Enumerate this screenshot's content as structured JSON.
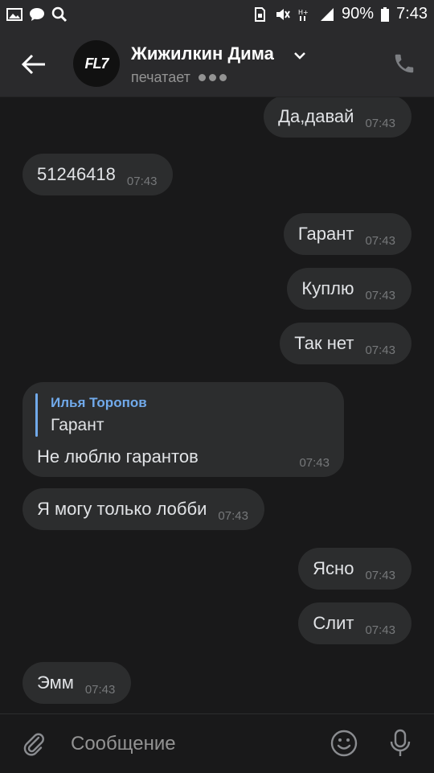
{
  "statusbar": {
    "battery": "90%",
    "time": "7:43"
  },
  "header": {
    "contact_name": "Жижилкин Дима",
    "status": "печатает",
    "avatar_text": "FL7"
  },
  "messages": [
    {
      "text": "Да,давай",
      "time": "07:43",
      "side": "out"
    },
    {
      "text": "51246418",
      "time": "07:43",
      "side": "in"
    },
    {
      "text": "Гарант",
      "time": "07:43",
      "side": "out"
    },
    {
      "text": "Куплю",
      "time": "07:43",
      "side": "out"
    },
    {
      "text": "Так нет",
      "time": "07:43",
      "side": "out"
    },
    {
      "text": "Я могу только лобби",
      "time": "07:43",
      "side": "in"
    },
    {
      "text": "Ясно",
      "time": "07:43",
      "side": "out"
    },
    {
      "text": "Слит",
      "time": "07:43",
      "side": "out"
    },
    {
      "text": "Эмм",
      "time": "07:43",
      "side": "in"
    }
  ],
  "reply_message": {
    "author": "Илья Торопов",
    "quoted": "Гарант",
    "text": "Не люблю гарантов",
    "time": "07:43"
  },
  "composer": {
    "placeholder": "Сообщение"
  },
  "colors": {
    "background": "#19191a",
    "bubble": "#2c2d2e",
    "accent": "#71aaeb"
  }
}
